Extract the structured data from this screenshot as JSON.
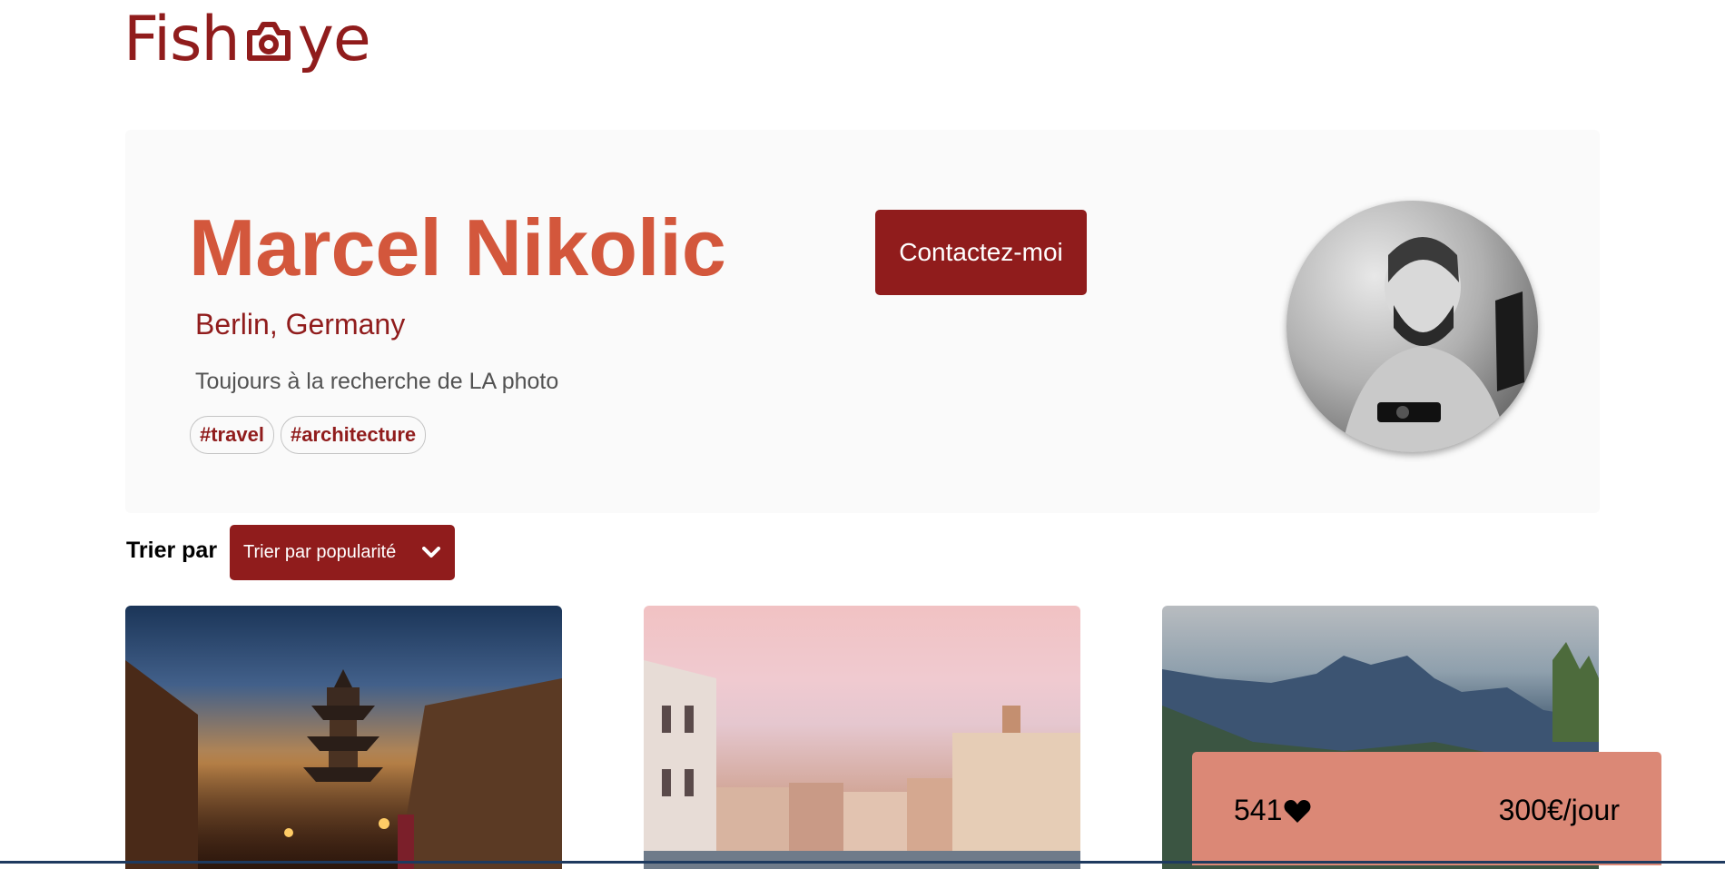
{
  "brand": {
    "logo_left": "Fish",
    "logo_right": "ye",
    "logo_icon": "camera-icon",
    "color": "#901C1C"
  },
  "photographer": {
    "name": "Marcel Nikolic",
    "location": "Berlin, Germany",
    "tagline": "Toujours à la recherche de LA photo",
    "tags": [
      "#travel",
      "#architecture"
    ],
    "contact_label": "Contactez-moi",
    "name_color": "#D3573C"
  },
  "sort": {
    "label": "Trier par",
    "selected": "Trier par popularité",
    "icon": "chevron-down-icon"
  },
  "media": [
    {
      "subject": "pagoda street at dusk"
    },
    {
      "subject": "venice canal at sunset"
    },
    {
      "subject": "mountain landscape"
    }
  ],
  "stats": {
    "likes": "541",
    "likes_icon": "heart-icon",
    "price": "300€/jour",
    "color": "#DB8876"
  }
}
